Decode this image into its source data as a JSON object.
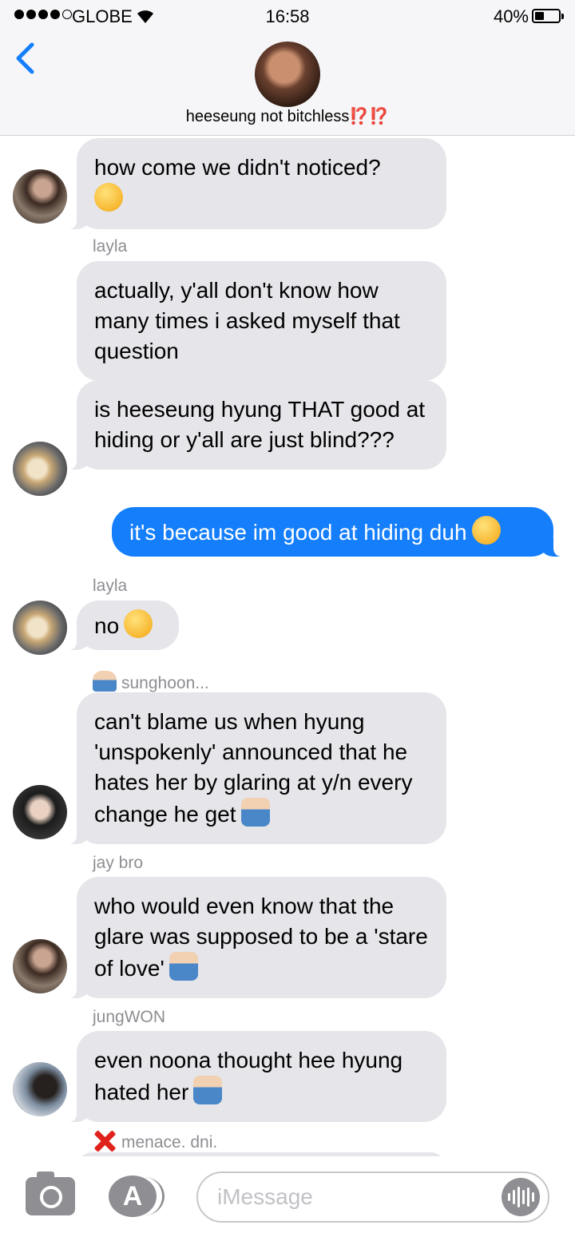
{
  "status_bar": {
    "carrier": "GLOBE",
    "time": "16:58",
    "battery_percent_label": "40%",
    "battery_level": 0.4,
    "signal_bars": 4
  },
  "header": {
    "group_name": "heeseung not bitchless",
    "group_name_marks": "⁉️⁉️",
    "back_icon": "chevron-left-icon"
  },
  "messages": [
    {
      "type": "incoming",
      "text": "how come we didn't noticed?",
      "emoji": "thinking-face",
      "sender": ""
    },
    {
      "type": "incoming",
      "text": "actually, y'all don't know how many times i asked myself that question",
      "emoji": "",
      "sender": "layla"
    },
    {
      "type": "incoming",
      "text": "is heeseung hyung THAT good at hiding or y'all are just blind???",
      "emoji": "",
      "sender": ""
    },
    {
      "type": "outgoing",
      "text": "it's because im good at hiding duh",
      "emoji": "relieved-face"
    },
    {
      "type": "incoming",
      "text": "no",
      "emoji": "smiling-face",
      "sender": "layla"
    },
    {
      "type": "incoming",
      "text": "can't blame us when hyung 'unspokenly' announced that he hates her by glaring at y/n every change he get",
      "emoji": "person-shrugging",
      "sender": "sunghoon..."
    },
    {
      "type": "incoming",
      "text": "who would even know that the glare was supposed to be a 'stare of love'",
      "emoji": "person-shrugging",
      "sender": "jay bro"
    },
    {
      "type": "incoming",
      "text": "even noona thought hee hyung hated her",
      "emoji": "person-shrugging",
      "sender": "jungWON"
    },
    {
      "type": "sender-only",
      "sender": "menace. dni."
    }
  ],
  "input_bar": {
    "placeholder": "iMessage",
    "camera_icon": "camera-icon",
    "appstore_icon": "app-store-icon",
    "audio_icon": "audio-waveform-icon"
  },
  "colors": {
    "incoming_bubble": "#e5e5ea",
    "outgoing_bubble": "#147efb",
    "accent": "#147efb",
    "name_marks": "#e0342c"
  }
}
